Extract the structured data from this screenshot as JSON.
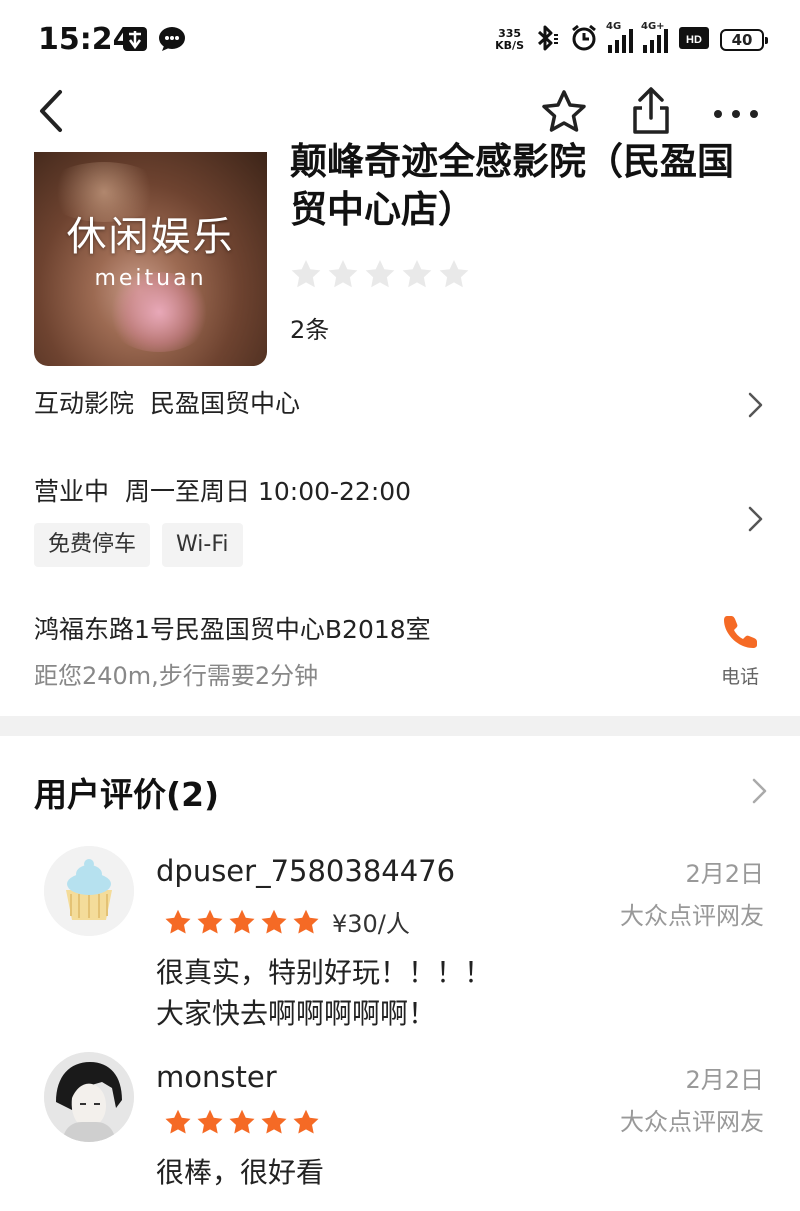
{
  "status_bar": {
    "time": "15:24",
    "net_speed_value": "335",
    "net_speed_unit": "KB/S",
    "signal1_tag": "4G",
    "signal2_tag": "4G+",
    "hd_label": "HD2",
    "battery": "40"
  },
  "nav": {
    "icons": [
      "back-icon",
      "star-outline-icon",
      "share-icon",
      "more-icon"
    ]
  },
  "shop": {
    "thumb_title": "休闲娱乐",
    "thumb_sub": "meituan",
    "name": "颠峰奇迹全感影院（民盈国贸中心店）",
    "rating_stars": 0,
    "review_count": "2条",
    "category": "互动影院",
    "area": "民盈国贸中心",
    "status": "营业中",
    "hours": "周一至周日 10:00-22:00",
    "tags": [
      "免费停车",
      "Wi-Fi"
    ],
    "address": "鸿福东路1号民盈国贸中心B2018室",
    "distance": "距您240m,步行需要2分钟",
    "phone_label": "电话"
  },
  "reviews": {
    "title": "用户评价(2)",
    "items": [
      {
        "user": "dpuser_7580384476",
        "date": "2月2日",
        "source": "大众点评网友",
        "stars": 5,
        "price": "¥30/人",
        "text_lines": [
          "很真实，特别好玩！！！！",
          "大家快去啊啊啊啊啊！"
        ]
      },
      {
        "user": "monster",
        "date": "2月2日",
        "source": "大众点评网友",
        "stars": 5,
        "price": "",
        "text_lines": [
          "很棒，很好看"
        ]
      }
    ]
  },
  "colors": {
    "accent_star": "#f56a25",
    "phone_orange": "#f56a25",
    "empty_star": "#e9e9e9",
    "divider": "#f1f1f1"
  }
}
